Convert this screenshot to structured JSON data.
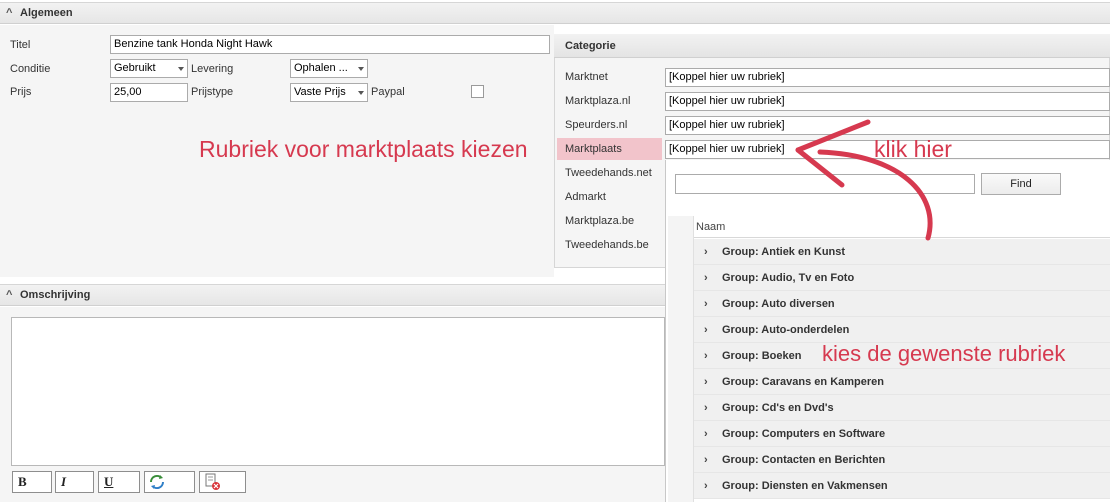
{
  "algemeen": {
    "header": "Algemeen",
    "titel_label": "Titel",
    "titel_value": "Benzine tank Honda Night Hawk",
    "conditie_label": "Conditie",
    "conditie_value": "Gebruikt",
    "levering_label": "Levering",
    "levering_value": "Ophalen ...",
    "prijs_label": "Prijs",
    "prijs_value": "25,00",
    "prijstype_label": "Prijstype",
    "prijstype_value": "Vaste Prijs",
    "paypal_label": "Paypal"
  },
  "categorie": {
    "header": "Categorie",
    "rows": [
      {
        "label": "Marktnet",
        "value": "[Koppel hier uw rubriek]"
      },
      {
        "label": "Marktplaza.nl",
        "value": "[Koppel hier uw rubriek]"
      },
      {
        "label": "Speurders.nl",
        "value": "[Koppel hier uw rubriek]"
      },
      {
        "label": "Marktplaats",
        "value": "[Koppel hier uw rubriek]"
      },
      {
        "label": "Tweedehands.net"
      },
      {
        "label": "Admarkt"
      },
      {
        "label": "Marktplaza.be"
      },
      {
        "label": "Tweedehands.be"
      }
    ]
  },
  "dropdown": {
    "find_label": "Find",
    "search_value": "",
    "column_header": "Naam",
    "groups": [
      "Group: Antiek en Kunst",
      "Group: Audio, Tv en Foto",
      "Group: Auto diversen",
      "Group: Auto-onderdelen",
      "Group: Boeken",
      "Group: Caravans en Kamperen",
      "Group: Cd's en Dvd's",
      "Group: Computers en Software",
      "Group: Contacten en Berichten",
      "Group: Diensten en Vakmensen"
    ]
  },
  "omschrijving": {
    "header": "Omschrijving",
    "bold_label": "B",
    "italic_label": "I",
    "underline_label": "U"
  },
  "annotations": {
    "rubriek": "Rubriek voor marktplaats kiezen",
    "klik": "klik hier",
    "kies": "kies de gewenste rubriek",
    "color": "#d6394f"
  }
}
